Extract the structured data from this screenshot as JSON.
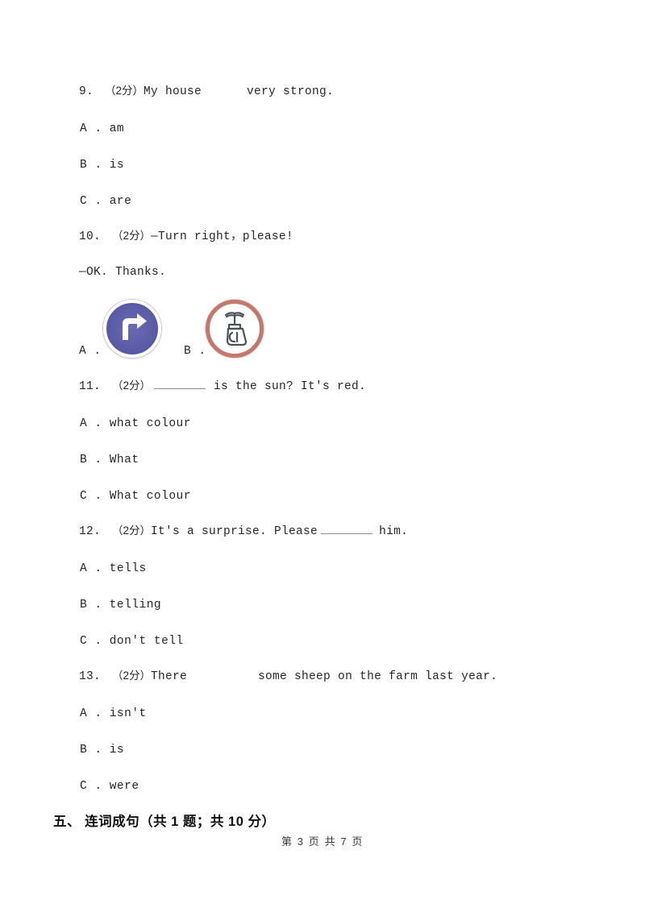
{
  "document": {
    "page_background": "#ffffff",
    "text_color": "#262626"
  },
  "questions": [
    {
      "number": "9.",
      "marks": "（2分）",
      "stem_before": "My house",
      "stem_after": "very strong.",
      "options": [
        {
          "label": "A .",
          "text": "am"
        },
        {
          "label": "B .",
          "text": "is"
        },
        {
          "label": "C .",
          "text": "are"
        }
      ]
    },
    {
      "number": "10.",
      "marks": "（2分）",
      "stem_before": "—Turn right，please!",
      "stem_line2": "—OK. Thanks.",
      "image_options": [
        {
          "label": "A .",
          "icon": "turn-right-sign-icon",
          "description": "blue circular mandatory turn right sign",
          "ring_color": "#ffffff",
          "fill_color": "#5a5aa6",
          "arrow_color": "#ffffff"
        },
        {
          "label": "B .",
          "icon": "no-honking-prohibition-sign-icon",
          "description": "red ringed prohibition sign with dark pictogram",
          "ring_color": "#c4776d",
          "fill_color": "#ffffff",
          "glyph_color": "#4a5357"
        }
      ]
    },
    {
      "number": "11.",
      "marks": "（2分）",
      "stem_blank": true,
      "stem_after": "is the sun? It's red.",
      "options": [
        {
          "label": "A .",
          "text": "what colour"
        },
        {
          "label": "B .",
          "text": "What"
        },
        {
          "label": "C .",
          "text": "What colour"
        }
      ]
    },
    {
      "number": "12.",
      "marks": "（2分）",
      "stem_before": "It's a surprise. Please",
      "stem_after": "him.",
      "options": [
        {
          "label": "A .",
          "text": "tells"
        },
        {
          "label": "B .",
          "text": "telling"
        },
        {
          "label": "C .",
          "text": "don't tell"
        }
      ]
    },
    {
      "number": "13.",
      "marks": "（2分）",
      "stem_before": "There",
      "stem_after": "some sheep on the farm last year.",
      "options": [
        {
          "label": "A .",
          "text": "isn't"
        },
        {
          "label": "B .",
          "text": "is"
        },
        {
          "label": "C .",
          "text": "were"
        }
      ]
    }
  ],
  "section_heading": "五、 连词成句（共 1 题；共 10 分）",
  "footer": "第 3 页 共 7 页"
}
